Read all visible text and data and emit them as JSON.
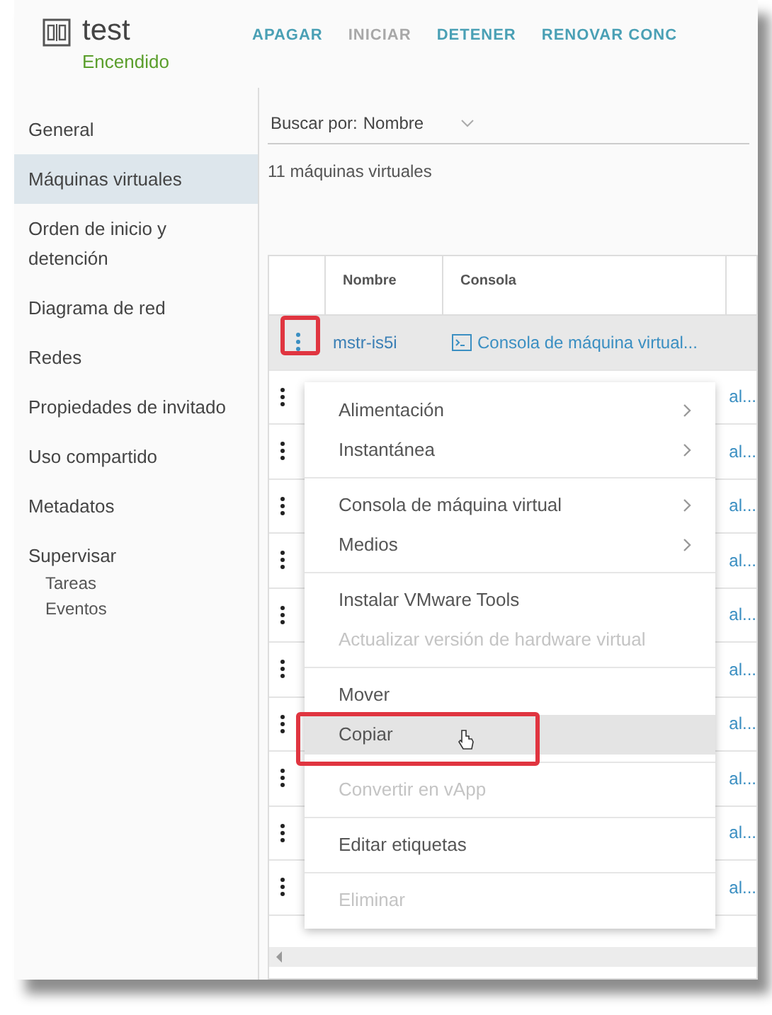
{
  "header": {
    "title": "test",
    "status": "Encendido",
    "actions": [
      {
        "label": "APAGAR",
        "disabled": false
      },
      {
        "label": "INICIAR",
        "disabled": true
      },
      {
        "label": "DETENER",
        "disabled": false
      },
      {
        "label": "RENOVAR CONC",
        "disabled": false
      }
    ]
  },
  "sidebar": {
    "items": [
      {
        "label": "General",
        "selected": false
      },
      {
        "label": "Máquinas virtuales",
        "selected": true
      },
      {
        "label": "Orden de inicio y detención",
        "selected": false
      },
      {
        "label": "Diagrama de red",
        "selected": false
      },
      {
        "label": "Redes",
        "selected": false
      },
      {
        "label": "Propiedades de invitado",
        "selected": false
      },
      {
        "label": "Uso compartido",
        "selected": false
      },
      {
        "label": "Metadatos",
        "selected": false
      },
      {
        "label": "Supervisar",
        "selected": false,
        "children": [
          {
            "label": "Tareas",
            "selected": false
          },
          {
            "label": "Eventos",
            "selected": false
          }
        ]
      }
    ]
  },
  "search": {
    "label": "Buscar por:",
    "value": "Nombre"
  },
  "count": "11 máquinas virtuales",
  "table": {
    "columns": [
      "Nombre",
      "Consola"
    ],
    "rows": [
      {
        "name": "mstr-is5i",
        "console": "Consola de máquina virtual...",
        "selected": true,
        "annotated": true
      },
      {
        "console": "al...",
        "selected": false,
        "annotated": false
      },
      {
        "console": "al...",
        "selected": false,
        "annotated": false
      },
      {
        "console": "al...",
        "selected": false,
        "annotated": false
      },
      {
        "console": "al...",
        "selected": false,
        "annotated": false
      },
      {
        "console": "al...",
        "selected": false,
        "annotated": false
      },
      {
        "console": "al...",
        "selected": false,
        "annotated": false
      },
      {
        "console": "al...",
        "selected": false,
        "annotated": false
      },
      {
        "console": "al...",
        "selected": false,
        "annotated": false
      },
      {
        "console": "al...",
        "selected": false,
        "annotated": false
      },
      {
        "console": "al...",
        "selected": false,
        "annotated": false
      }
    ]
  },
  "context_menu": {
    "groups": [
      [
        {
          "label": "Alimentación",
          "submenu": true,
          "disabled": false,
          "selected": false,
          "annotated": false
        },
        {
          "label": "Instantánea",
          "submenu": true,
          "disabled": false,
          "selected": false,
          "annotated": false
        }
      ],
      [
        {
          "label": "Consola de máquina virtual",
          "submenu": true,
          "disabled": false,
          "selected": false,
          "annotated": false
        },
        {
          "label": "Medios",
          "submenu": true,
          "disabled": false,
          "selected": false,
          "annotated": false
        }
      ],
      [
        {
          "label": "Instalar VMware Tools",
          "submenu": false,
          "disabled": false,
          "selected": false,
          "annotated": false
        },
        {
          "label": "Actualizar versión de hardware virtual",
          "submenu": false,
          "disabled": true,
          "selected": false,
          "annotated": false
        }
      ],
      [
        {
          "label": "Mover",
          "submenu": false,
          "disabled": false,
          "selected": false,
          "annotated": false
        },
        {
          "label": "Copiar",
          "submenu": false,
          "disabled": false,
          "selected": true,
          "annotated": true
        }
      ],
      [
        {
          "label": "Convertir en vApp",
          "submenu": false,
          "disabled": true,
          "selected": false,
          "annotated": false
        }
      ],
      [
        {
          "label": "Editar etiquetas",
          "submenu": false,
          "disabled": false,
          "selected": false,
          "annotated": false
        }
      ],
      [
        {
          "label": "Eliminar",
          "submenu": false,
          "disabled": true,
          "selected": false,
          "annotated": false
        }
      ]
    ]
  }
}
